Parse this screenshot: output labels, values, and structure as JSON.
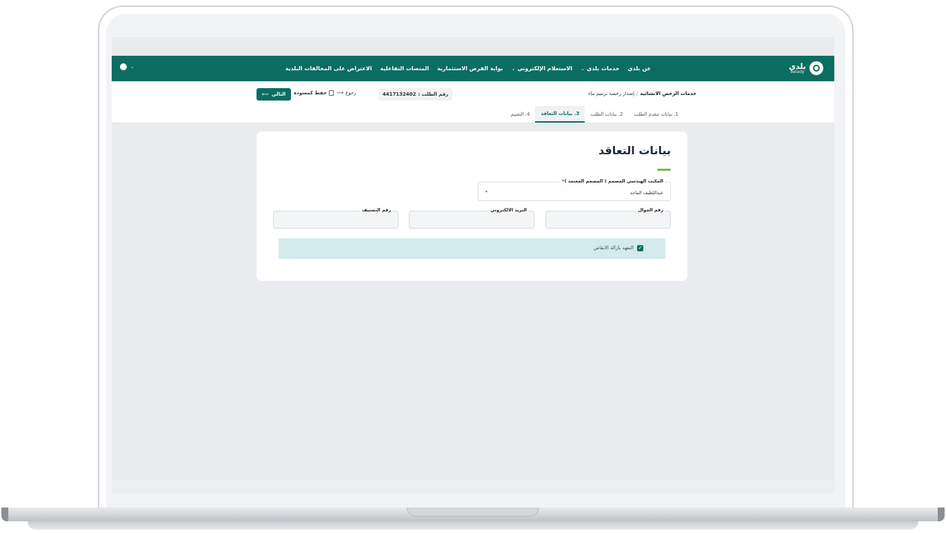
{
  "nav": {
    "brand_ar": "بلدي",
    "brand_en": "balady",
    "items": [
      {
        "label": "عن بلدي",
        "dropdown": false
      },
      {
        "label": "خدمات بلدي",
        "dropdown": true
      },
      {
        "label": "الاستعلام الإلكتروني",
        "dropdown": true
      },
      {
        "label": "بوابة الفرص الاستثمارية",
        "dropdown": false
      },
      {
        "label": "المنصات التفاعلية",
        "dropdown": false
      },
      {
        "label": "الاعتراض على المخالفات البلدية",
        "dropdown": false
      }
    ],
    "language_icon": "globe-icon"
  },
  "header": {
    "breadcrumb_main": "خدمات الرخص الانشائية",
    "breadcrumb_sep": "/",
    "breadcrumb_sub": "إصدار رخصة ترميم بناء",
    "request_label": "رقم الطلب :",
    "request_number": "4417132402",
    "back_label": "رجوع",
    "draft_label": "حفظ كمسودة",
    "next_label": "التالي"
  },
  "steps": [
    {
      "num": "1.",
      "label": "بيانات مقدم الطلب",
      "active": false
    },
    {
      "num": "2.",
      "label": "بيانات الطلب",
      "active": false
    },
    {
      "num": "3.",
      "label": "بيانات التعاقد",
      "active": true
    },
    {
      "num": "4.",
      "label": "التقييم",
      "active": false
    }
  ],
  "form": {
    "title": "بيانات التعاقد",
    "office_label": "المكتب الهندسي المصمم ( المصمم المعتمد )",
    "office_value": "عبداللطيف الماجد",
    "mobile_label": "رقم الجوال",
    "mobile_value": "",
    "email_label": "البريد الالكتروني",
    "email_value": "",
    "classification_label": "رقم التصنيف",
    "classification_value": "",
    "pledge_label": "التعهد بازالة الانقاض",
    "pledge_checked": true
  },
  "colors": {
    "primary": "#0c6d62",
    "accent": "#7db543",
    "info_bg": "#d4ebee",
    "required": "#d0021b"
  }
}
